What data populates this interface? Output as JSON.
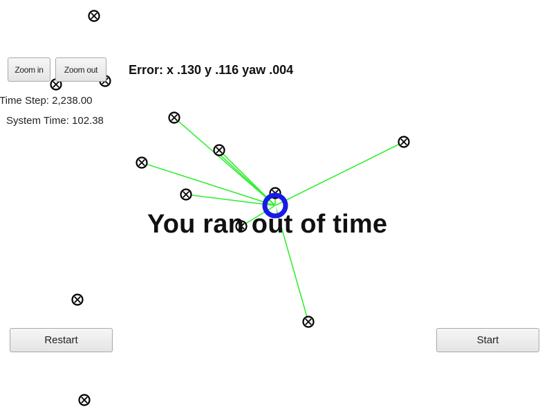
{
  "controls": {
    "zoom_in_label": "Zoom in",
    "zoom_out_label": "Zoom out",
    "restart_label": "Restart",
    "start_label": "Start"
  },
  "status": {
    "time_step": "Time Step: 2,238.00",
    "system_time": "System Time: 102.38",
    "error": "Error: x .130 y .116 yaw .004",
    "message": "You ran out of time"
  },
  "colors": {
    "background": "#ffffff",
    "observation_line": "#33ee33",
    "robot": "#1a1ae6",
    "landmark": "#000000"
  },
  "icons": {
    "landmark": "landmark-marker-icon",
    "robot": "robot-icon"
  }
}
